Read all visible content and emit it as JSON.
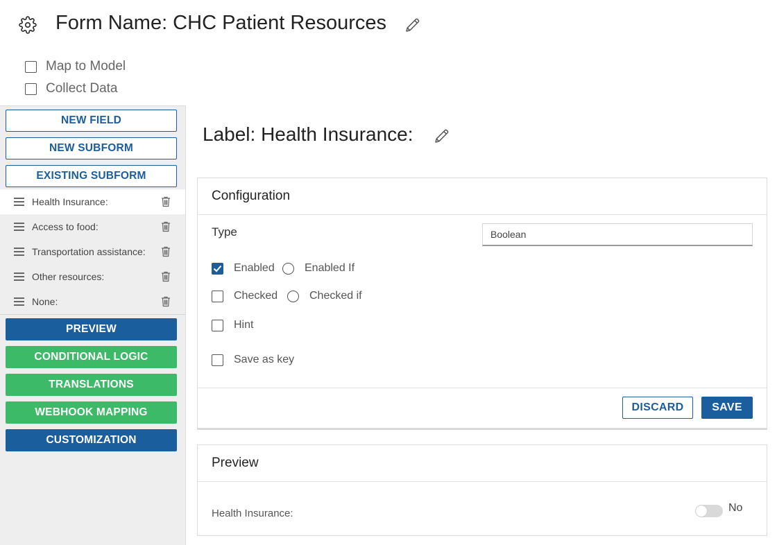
{
  "header": {
    "title": "Form Name: CHC Patient Resources",
    "options": [
      {
        "label": "Map to Model",
        "checked": false
      },
      {
        "label": "Collect Data",
        "checked": false
      }
    ]
  },
  "sidebar": {
    "top_buttons": [
      "NEW FIELD",
      "NEW SUBFORM",
      "EXISTING SUBFORM"
    ],
    "fields": [
      {
        "label": "Health Insurance:",
        "active": true
      },
      {
        "label": "Access to food:",
        "active": false
      },
      {
        "label": "Transportation assistance:",
        "active": false
      },
      {
        "label": "Other resources:",
        "active": false
      },
      {
        "label": "None:",
        "active": false
      }
    ],
    "bottom_buttons": [
      {
        "label": "PREVIEW",
        "color": "#1b5e9e"
      },
      {
        "label": "CONDITIONAL LOGIC",
        "color": "#3dba67"
      },
      {
        "label": "TRANSLATIONS",
        "color": "#3dba67"
      },
      {
        "label": "WEBHOOK MAPPING",
        "color": "#3dba67"
      },
      {
        "label": "CUSTOMIZATION",
        "color": "#1b5e9e"
      }
    ]
  },
  "main": {
    "label_title": "Label: Health Insurance:",
    "configuration": {
      "heading": "Configuration",
      "type_label": "Type",
      "type_value": "Boolean",
      "options": {
        "enabled": {
          "label": "Enabled",
          "checked": true
        },
        "enabled_if": {
          "label": "Enabled If",
          "checked": false
        },
        "checked": {
          "label": "Checked",
          "checked": false
        },
        "checked_if": {
          "label": "Checked if",
          "checked": false
        },
        "hint": {
          "label": "Hint",
          "checked": false
        },
        "save_as_key": {
          "label": "Save as key",
          "checked": false
        }
      },
      "discard_label": "DISCARD",
      "save_label": "SAVE"
    },
    "preview": {
      "heading": "Preview",
      "field_label": "Health Insurance:",
      "toggle_value": "No",
      "toggle_on": false
    }
  },
  "colors": {
    "primary": "#1b5e9e",
    "success": "#3dba67",
    "sidebar_bg": "#eeeeee"
  }
}
